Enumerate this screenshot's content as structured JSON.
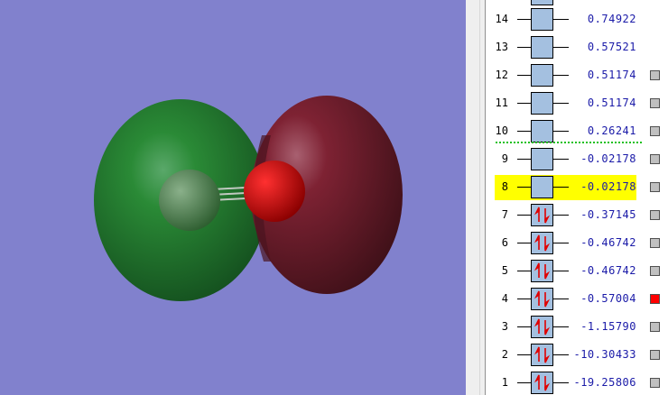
{
  "viewer": {
    "background": "#8181cd",
    "positive_lobe_color": "#1f7a2a",
    "negative_lobe_color": "#7a1a2c"
  },
  "orbitals": [
    {
      "index": "14",
      "energy": "0.74922",
      "occupied": false,
      "selectable": false,
      "checked": false,
      "highlighted": false
    },
    {
      "index": "13",
      "energy": "0.57521",
      "occupied": false,
      "selectable": false,
      "checked": false,
      "highlighted": false
    },
    {
      "index": "12",
      "energy": "0.51174",
      "occupied": false,
      "selectable": true,
      "checked": false,
      "highlighted": false
    },
    {
      "index": "11",
      "energy": "0.51174",
      "occupied": false,
      "selectable": true,
      "checked": false,
      "highlighted": false
    },
    {
      "index": "10",
      "energy": "0.26241",
      "occupied": false,
      "selectable": true,
      "checked": false,
      "highlighted": false
    },
    {
      "index": "9",
      "energy": "-0.02178",
      "occupied": false,
      "selectable": true,
      "checked": false,
      "highlighted": false
    },
    {
      "index": "8",
      "energy": "-0.02178",
      "occupied": false,
      "selectable": true,
      "checked": false,
      "highlighted": true
    },
    {
      "index": "7",
      "energy": "-0.37145",
      "occupied": true,
      "selectable": true,
      "checked": false,
      "highlighted": false
    },
    {
      "index": "6",
      "energy": "-0.46742",
      "occupied": true,
      "selectable": true,
      "checked": false,
      "highlighted": false
    },
    {
      "index": "5",
      "energy": "-0.46742",
      "occupied": true,
      "selectable": true,
      "checked": false,
      "highlighted": false
    },
    {
      "index": "4",
      "energy": "-0.57004",
      "occupied": true,
      "selectable": true,
      "checked": true,
      "highlighted": false
    },
    {
      "index": "3",
      "energy": "-1.15790",
      "occupied": true,
      "selectable": true,
      "checked": false,
      "highlighted": false
    },
    {
      "index": "2",
      "energy": "-10.30433",
      "occupied": true,
      "selectable": true,
      "checked": false,
      "highlighted": false
    },
    {
      "index": "1",
      "energy": "-19.25806",
      "occupied": true,
      "selectable": true,
      "checked": false,
      "highlighted": false
    }
  ]
}
